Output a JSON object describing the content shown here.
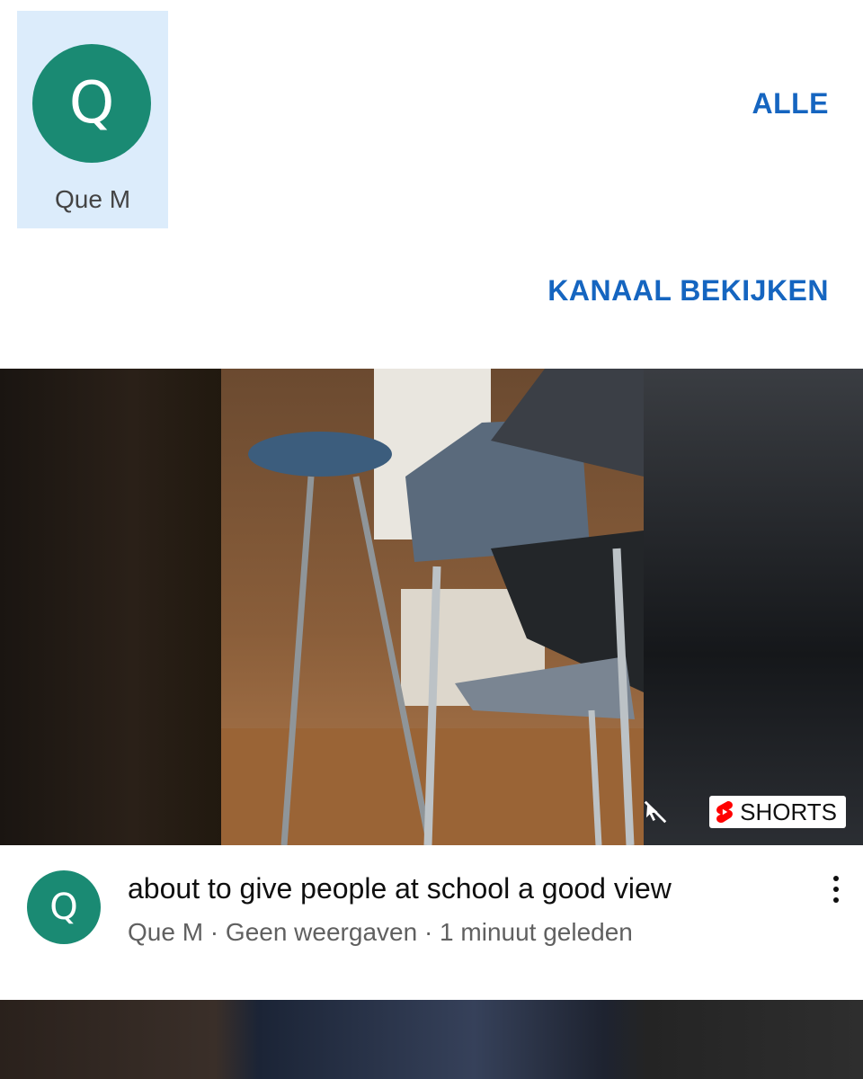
{
  "channel_chip": {
    "avatar_letter": "Q",
    "name": "Que M",
    "avatar_color": "#1a8a73",
    "selected_bg": "#dcecfb"
  },
  "links": {
    "all": "ALLE",
    "view_channel": "KANAAL BEKIJKEN",
    "link_color": "#1565c0"
  },
  "video": {
    "badge_label": "SHORTS",
    "title": "about to give people at school a good view",
    "avatar_letter": "Q",
    "meta": "Que M · Geen weergaven · 1 minuut geleden",
    "more_icon": "more-vert-icon"
  }
}
